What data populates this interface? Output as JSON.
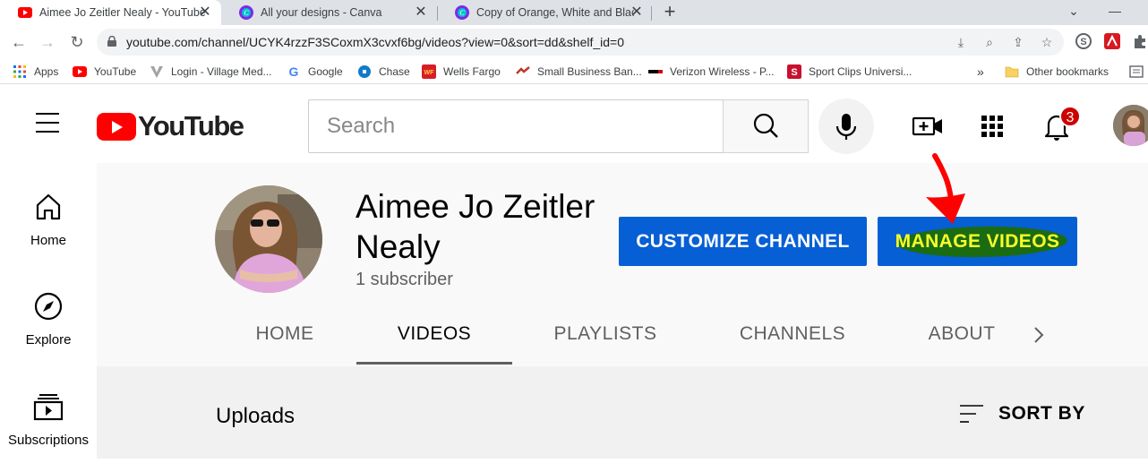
{
  "browser": {
    "tabs": [
      {
        "title": "Aimee Jo Zeitler Nealy - YouTube",
        "active": true
      },
      {
        "title": "All your designs - Canva",
        "active": false
      },
      {
        "title": "Copy of Orange, White and Black",
        "active": false
      }
    ],
    "url": "youtube.com/channel/UCYK4rzzF3SCoxmX3cvxf6bg/videos?view=0&sort=dd&shelf_id=0",
    "bookmarks": [
      {
        "label": "Apps",
        "icon": "apps-grid-icon"
      },
      {
        "label": "YouTube",
        "icon": "youtube-icon"
      },
      {
        "label": "Login - Village Med...",
        "icon": "village-medical-icon"
      },
      {
        "label": "Google",
        "icon": "google-icon"
      },
      {
        "label": "Chase",
        "icon": "chase-icon"
      },
      {
        "label": "Wells Fargo",
        "icon": "wells-fargo-icon"
      },
      {
        "label": "Small Business Ban...",
        "icon": "bank-icon"
      },
      {
        "label": "Verizon Wireless - P...",
        "icon": "verizon-icon"
      },
      {
        "label": "Sport Clips Universi...",
        "icon": "sport-clips-icon"
      }
    ],
    "more_bookmarks": "»",
    "other_bookmarks": "Other bookmarks"
  },
  "masthead": {
    "logo_text": "YouTube",
    "search_placeholder": "Search",
    "notification_count": "3"
  },
  "guide": {
    "items": [
      {
        "label": "Home",
        "icon": "home-icon"
      },
      {
        "label": "Explore",
        "icon": "compass-icon"
      },
      {
        "label": "Subscriptions",
        "icon": "subscriptions-icon"
      }
    ]
  },
  "channel": {
    "name": "Aimee Jo Zeitler Nealy",
    "subscribers": "1 subscriber",
    "customize_label": "CUSTOMIZE CHANNEL",
    "manage_label": "MANAGE VIDEOS",
    "tabs": [
      {
        "label": "HOME",
        "active": false
      },
      {
        "label": "VIDEOS",
        "active": true
      },
      {
        "label": "PLAYLISTS",
        "active": false
      },
      {
        "label": "CHANNELS",
        "active": false
      },
      {
        "label": "ABOUT",
        "active": false
      }
    ]
  },
  "content": {
    "section_title": "Uploads",
    "sort_label": "SORT BY"
  },
  "colors": {
    "youtube_red": "#ff0000",
    "button_blue": "#065fd4",
    "highlight_yellow": "#f7ff2a",
    "highlight_green": "#1b6b13",
    "annotation_red": "#ff0000"
  }
}
